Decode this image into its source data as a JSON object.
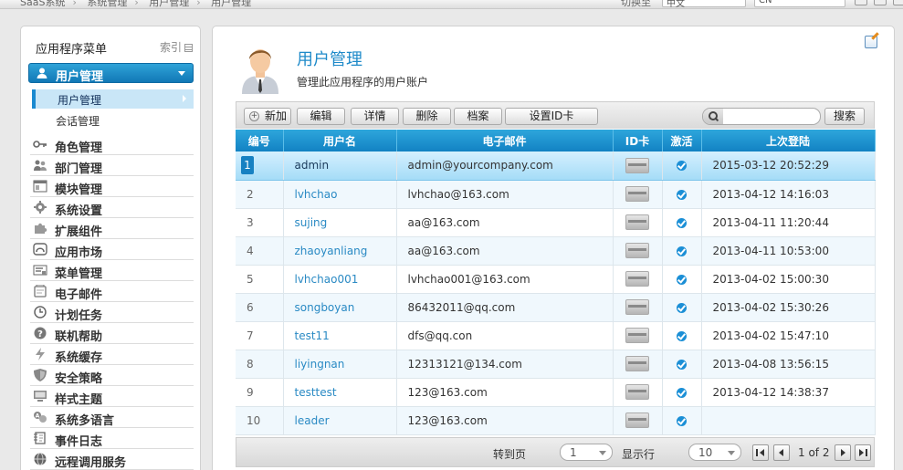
{
  "topbar": {
    "breadcrumbs": [
      "SaaS系统",
      "系统管理",
      "用户管理",
      "用户管理"
    ],
    "lang_label": "切换至",
    "lang_value": "中文",
    "region_value": "CN"
  },
  "sidebar": {
    "title": "应用程序菜单",
    "index_label": "索引",
    "active_group": "用户管理",
    "sub_items": [
      {
        "label": "用户管理",
        "active": true
      },
      {
        "label": "会话管理",
        "active": false
      }
    ],
    "items": [
      {
        "label": "角色管理",
        "icon": "key-icon"
      },
      {
        "label": "部门管理",
        "icon": "people-icon"
      },
      {
        "label": "模块管理",
        "icon": "window-icon"
      },
      {
        "label": "系统设置",
        "icon": "gear-icon"
      },
      {
        "label": "扩展组件",
        "icon": "puzzle-icon"
      },
      {
        "label": "应用市场",
        "icon": "market-icon"
      },
      {
        "label": "菜单管理",
        "icon": "menu-icon"
      },
      {
        "label": "电子邮件",
        "icon": "mail-icon"
      },
      {
        "label": "计划任务",
        "icon": "clock-icon"
      },
      {
        "label": "联机帮助",
        "icon": "help-icon"
      },
      {
        "label": "系统缓存",
        "icon": "lightning-icon"
      },
      {
        "label": "安全策略",
        "icon": "shield-icon"
      },
      {
        "label": "样式主题",
        "icon": "monitor-icon"
      },
      {
        "label": "系统多语言",
        "icon": "translate-icon"
      },
      {
        "label": "事件日志",
        "icon": "log-icon"
      },
      {
        "label": "远程调用服务",
        "icon": "globe-icon"
      }
    ]
  },
  "header": {
    "title": "用户管理",
    "description": "管理此应用程序的用户账户"
  },
  "toolbar": {
    "add_label": "新加",
    "edit_label": "编辑",
    "detail_label": "详情",
    "delete_label": "删除",
    "archive_label": "档案",
    "idcard_label": "设置ID卡",
    "search_placeholder": "",
    "search_label": "搜索"
  },
  "table": {
    "columns": [
      "编号",
      "用户名",
      "电子邮件",
      "ID卡",
      "激活",
      "上次登陆"
    ],
    "rows": [
      {
        "id": "1",
        "username": "admin",
        "email": "admin@yourcompany.com",
        "last_login": "2015-03-12 20:52:29",
        "selected": true
      },
      {
        "id": "2",
        "username": "lvhchao",
        "email": "lvhchao@163.com",
        "last_login": "2013-04-12 14:16:03"
      },
      {
        "id": "3",
        "username": "sujing",
        "email": "aa@163.com",
        "last_login": "2013-04-11 11:20:44"
      },
      {
        "id": "4",
        "username": "zhaoyanliang",
        "email": "aa@163.com",
        "last_login": "2013-04-11 10:53:00"
      },
      {
        "id": "5",
        "username": "lvhchao001",
        "email": "lvhchao001@163.com",
        "last_login": "2013-04-02 15:00:30"
      },
      {
        "id": "6",
        "username": "songboyan",
        "email": "86432011@qq.com",
        "last_login": "2013-04-02 15:30:26"
      },
      {
        "id": "7",
        "username": "test11",
        "email": "dfs@qq.con",
        "last_login": "2013-04-02 15:47:10"
      },
      {
        "id": "8",
        "username": "liyingnan",
        "email": "12313121@134.com",
        "last_login": "2013-04-08 13:56:15"
      },
      {
        "id": "9",
        "username": "testtest",
        "email": "123@163.com",
        "last_login": "2013-04-12 14:38:37"
      },
      {
        "id": "10",
        "username": "leader",
        "email": "123@163.com",
        "last_login": ""
      }
    ]
  },
  "pager": {
    "goto_label": "转到页",
    "page_value": "1",
    "rows_label": "显示行",
    "rows_value": "10",
    "page_info": "1 of 2"
  },
  "colors": {
    "accent": "#1e8ac9",
    "header_bg": "#1282c3",
    "selected_row": "#a5dcf7"
  }
}
